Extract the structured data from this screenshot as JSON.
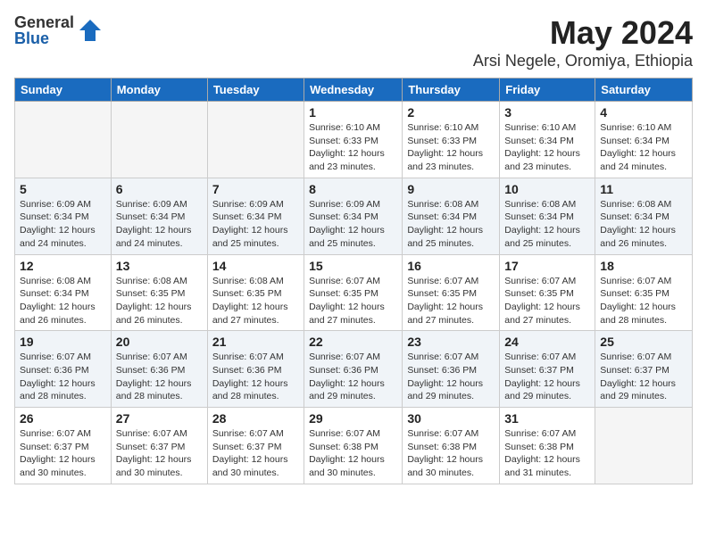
{
  "logo": {
    "general": "General",
    "blue": "Blue"
  },
  "title": "May 2024",
  "location": "Arsi Negele, Oromiya, Ethiopia",
  "headers": [
    "Sunday",
    "Monday",
    "Tuesday",
    "Wednesday",
    "Thursday",
    "Friday",
    "Saturday"
  ],
  "weeks": [
    [
      {
        "day": "",
        "info": ""
      },
      {
        "day": "",
        "info": ""
      },
      {
        "day": "",
        "info": ""
      },
      {
        "day": "1",
        "info": "Sunrise: 6:10 AM\nSunset: 6:33 PM\nDaylight: 12 hours\nand 23 minutes."
      },
      {
        "day": "2",
        "info": "Sunrise: 6:10 AM\nSunset: 6:33 PM\nDaylight: 12 hours\nand 23 minutes."
      },
      {
        "day": "3",
        "info": "Sunrise: 6:10 AM\nSunset: 6:34 PM\nDaylight: 12 hours\nand 23 minutes."
      },
      {
        "day": "4",
        "info": "Sunrise: 6:10 AM\nSunset: 6:34 PM\nDaylight: 12 hours\nand 24 minutes."
      }
    ],
    [
      {
        "day": "5",
        "info": "Sunrise: 6:09 AM\nSunset: 6:34 PM\nDaylight: 12 hours\nand 24 minutes."
      },
      {
        "day": "6",
        "info": "Sunrise: 6:09 AM\nSunset: 6:34 PM\nDaylight: 12 hours\nand 24 minutes."
      },
      {
        "day": "7",
        "info": "Sunrise: 6:09 AM\nSunset: 6:34 PM\nDaylight: 12 hours\nand 25 minutes."
      },
      {
        "day": "8",
        "info": "Sunrise: 6:09 AM\nSunset: 6:34 PM\nDaylight: 12 hours\nand 25 minutes."
      },
      {
        "day": "9",
        "info": "Sunrise: 6:08 AM\nSunset: 6:34 PM\nDaylight: 12 hours\nand 25 minutes."
      },
      {
        "day": "10",
        "info": "Sunrise: 6:08 AM\nSunset: 6:34 PM\nDaylight: 12 hours\nand 25 minutes."
      },
      {
        "day": "11",
        "info": "Sunrise: 6:08 AM\nSunset: 6:34 PM\nDaylight: 12 hours\nand 26 minutes."
      }
    ],
    [
      {
        "day": "12",
        "info": "Sunrise: 6:08 AM\nSunset: 6:34 PM\nDaylight: 12 hours\nand 26 minutes."
      },
      {
        "day": "13",
        "info": "Sunrise: 6:08 AM\nSunset: 6:35 PM\nDaylight: 12 hours\nand 26 minutes."
      },
      {
        "day": "14",
        "info": "Sunrise: 6:08 AM\nSunset: 6:35 PM\nDaylight: 12 hours\nand 27 minutes."
      },
      {
        "day": "15",
        "info": "Sunrise: 6:07 AM\nSunset: 6:35 PM\nDaylight: 12 hours\nand 27 minutes."
      },
      {
        "day": "16",
        "info": "Sunrise: 6:07 AM\nSunset: 6:35 PM\nDaylight: 12 hours\nand 27 minutes."
      },
      {
        "day": "17",
        "info": "Sunrise: 6:07 AM\nSunset: 6:35 PM\nDaylight: 12 hours\nand 27 minutes."
      },
      {
        "day": "18",
        "info": "Sunrise: 6:07 AM\nSunset: 6:35 PM\nDaylight: 12 hours\nand 28 minutes."
      }
    ],
    [
      {
        "day": "19",
        "info": "Sunrise: 6:07 AM\nSunset: 6:36 PM\nDaylight: 12 hours\nand 28 minutes."
      },
      {
        "day": "20",
        "info": "Sunrise: 6:07 AM\nSunset: 6:36 PM\nDaylight: 12 hours\nand 28 minutes."
      },
      {
        "day": "21",
        "info": "Sunrise: 6:07 AM\nSunset: 6:36 PM\nDaylight: 12 hours\nand 28 minutes."
      },
      {
        "day": "22",
        "info": "Sunrise: 6:07 AM\nSunset: 6:36 PM\nDaylight: 12 hours\nand 29 minutes."
      },
      {
        "day": "23",
        "info": "Sunrise: 6:07 AM\nSunset: 6:36 PM\nDaylight: 12 hours\nand 29 minutes."
      },
      {
        "day": "24",
        "info": "Sunrise: 6:07 AM\nSunset: 6:37 PM\nDaylight: 12 hours\nand 29 minutes."
      },
      {
        "day": "25",
        "info": "Sunrise: 6:07 AM\nSunset: 6:37 PM\nDaylight: 12 hours\nand 29 minutes."
      }
    ],
    [
      {
        "day": "26",
        "info": "Sunrise: 6:07 AM\nSunset: 6:37 PM\nDaylight: 12 hours\nand 30 minutes."
      },
      {
        "day": "27",
        "info": "Sunrise: 6:07 AM\nSunset: 6:37 PM\nDaylight: 12 hours\nand 30 minutes."
      },
      {
        "day": "28",
        "info": "Sunrise: 6:07 AM\nSunset: 6:37 PM\nDaylight: 12 hours\nand 30 minutes."
      },
      {
        "day": "29",
        "info": "Sunrise: 6:07 AM\nSunset: 6:38 PM\nDaylight: 12 hours\nand 30 minutes."
      },
      {
        "day": "30",
        "info": "Sunrise: 6:07 AM\nSunset: 6:38 PM\nDaylight: 12 hours\nand 30 minutes."
      },
      {
        "day": "31",
        "info": "Sunrise: 6:07 AM\nSunset: 6:38 PM\nDaylight: 12 hours\nand 31 minutes."
      },
      {
        "day": "",
        "info": ""
      }
    ]
  ]
}
